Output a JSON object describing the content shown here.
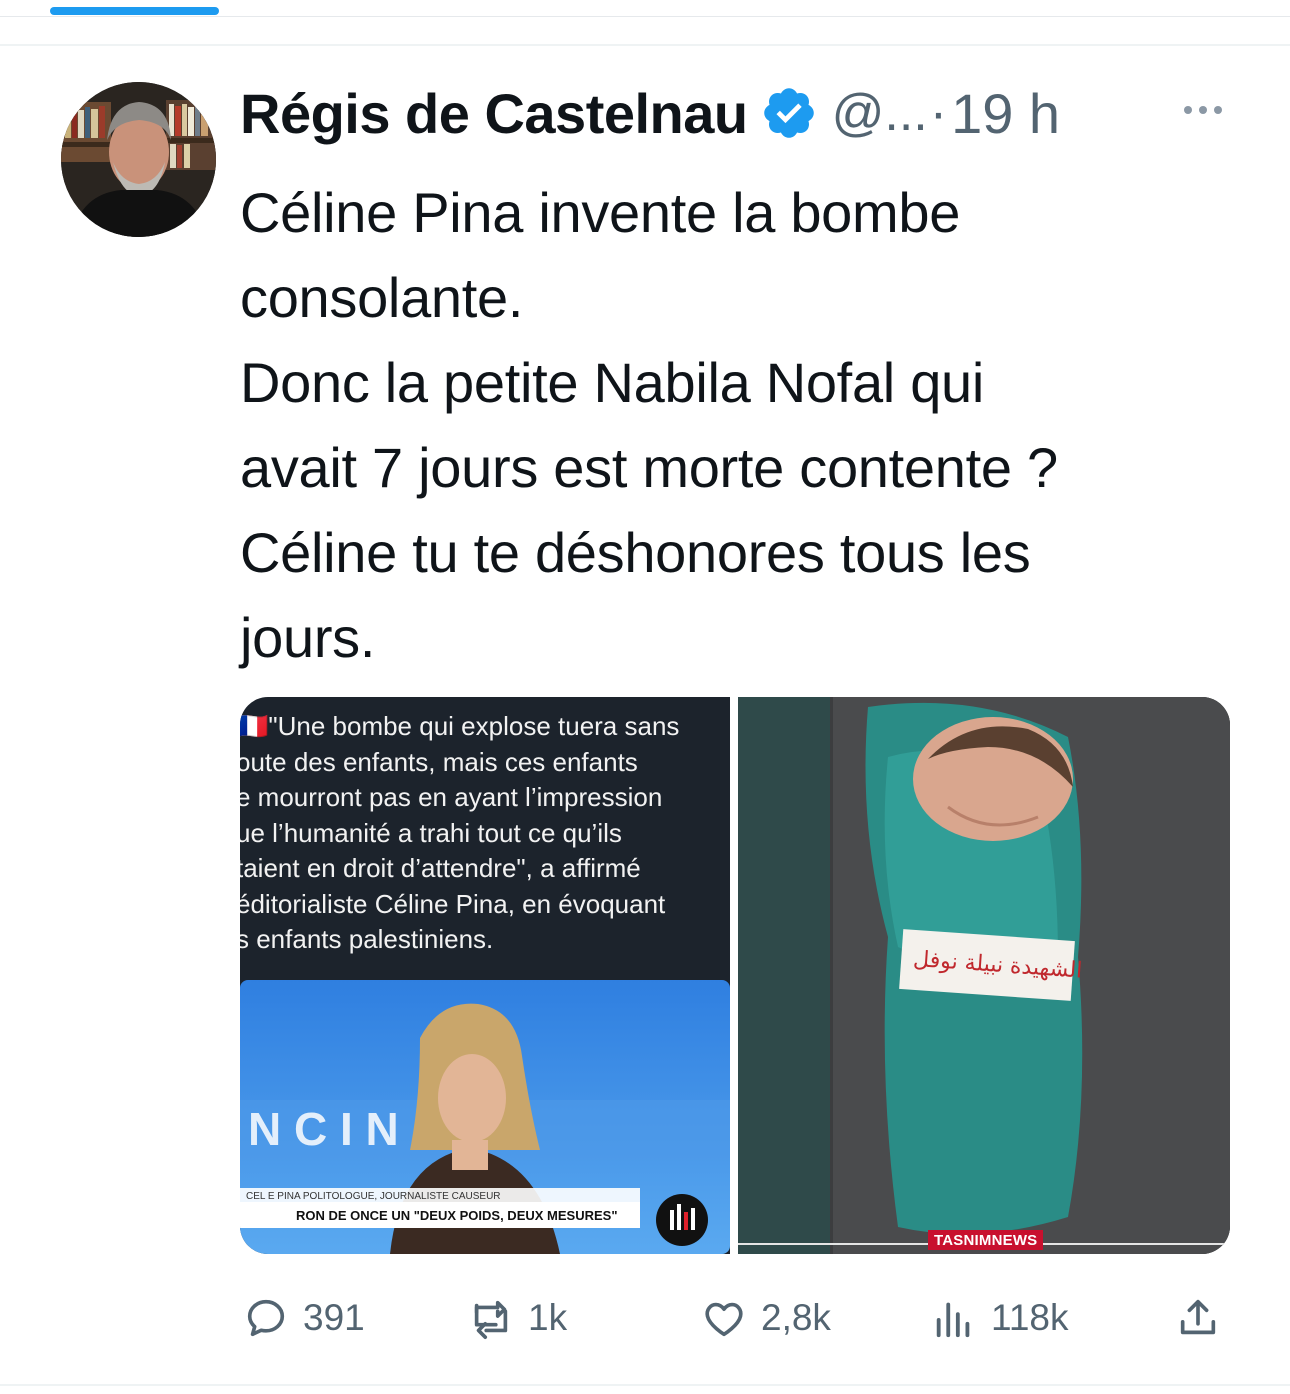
{
  "colors": {
    "accent": "#1d9bf0",
    "text": "#0f1419",
    "secondary": "#536471",
    "tasnim_red": "#c8102e"
  },
  "tweet": {
    "author_name": "Régis de Castelnau",
    "handle": "@...",
    "separator": "·",
    "time": "19 h",
    "more_icon": "more-horizontal-icon",
    "verified_icon": "verified-badge-icon",
    "text": "Céline Pina invente la bombe\nconsolante.\nDonc la petite Nabila Nofal qui\navait 7 jours est morte contente ?\nCéline tu te déshonores tous les\njours."
  },
  "media": {
    "left": {
      "quote_text": "🇫🇷\"Une bombe qui explose tuera sans\noute des enfants, mais ces enfants\ne mourront pas en ayant l’impression\nue l’humanité a trahi tout ce qu’ils\ntaient en droit d’attendre\", a affirmé\néditorialiste Céline Pina, en évoquant\ns enfants palestiniens.",
      "chyron_name": "CEL E PINA POLITOLOGUE, JOURNALISTE CAUSEUR",
      "chyron_text": "RON DE ONCE UN \"DEUX POIDS, DEUX MESURES\"",
      "studio_letters": "N C   I N"
    },
    "right": {
      "name_tag": "الشهيدة نبيلة نوفل",
      "watermark": "TASNIMNEWS"
    }
  },
  "actions": {
    "replies": "391",
    "retweets": "1k",
    "likes": "2,8k",
    "views": "118k",
    "icons": [
      "reply-icon",
      "retweet-icon",
      "like-icon",
      "views-icon",
      "share-icon"
    ]
  }
}
